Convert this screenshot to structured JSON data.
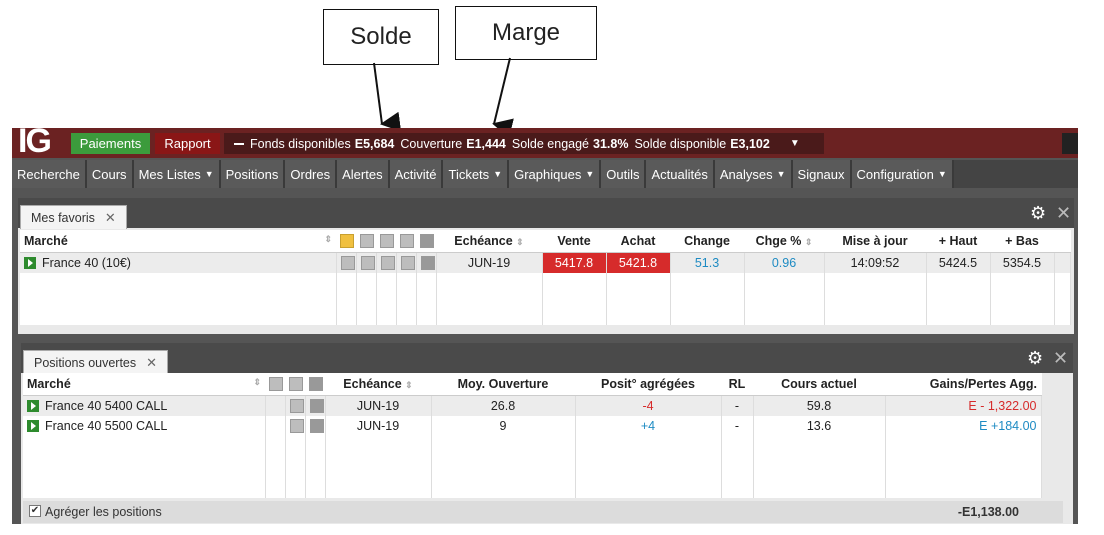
{
  "annotations": {
    "solde": "Solde",
    "marge": "Marge"
  },
  "topbar": {
    "logo": "IG",
    "payments": "Paiements",
    "report": "Rapport",
    "funds_label": "Fonds disponibles",
    "funds_value": "E5,684",
    "coverage_label": "Couverture",
    "coverage_value": "E1,444",
    "committed_label": "Solde engagé",
    "committed_value": "31.8%",
    "available_label": "Solde disponible",
    "available_value": "E3,102"
  },
  "menu": {
    "items": [
      "Recherche",
      "Cours",
      "Mes Listes",
      "Positions",
      "Ordres",
      "Alertes",
      "Activité",
      "Tickets",
      "Graphiques",
      "Outils",
      "Actualités",
      "Analyses",
      "Signaux",
      "Configuration"
    ]
  },
  "favorites": {
    "tab": "Mes favoris",
    "headers": {
      "market": "Marché",
      "expiry": "Echéance",
      "sell": "Vente",
      "buy": "Achat",
      "change": "Change",
      "change_pct": "Chge %",
      "updated": "Mise à jour",
      "high": "+ Haut",
      "low": "+ Bas"
    },
    "rows": [
      {
        "market": "France 40 (10€)",
        "expiry": "JUN-19",
        "sell": "5417.8",
        "buy": "5421.8",
        "change": "51.3",
        "change_pct": "0.96",
        "updated": "14:09:52",
        "high": "5424.5",
        "low": "5354.5"
      }
    ]
  },
  "positions": {
    "tab": "Positions ouvertes",
    "headers": {
      "market": "Marché",
      "expiry": "Echéance",
      "avg_open": "Moy. Ouverture",
      "aggregated": "Posit° agrégées",
      "rl": "RL",
      "current": "Cours actuel",
      "pnl": "Gains/Pertes Agg."
    },
    "rows": [
      {
        "market": "France 40 5400 CALL",
        "expiry": "JUN-19",
        "avg_open": "26.8",
        "aggregated": "-4",
        "rl": "-",
        "current": "59.8",
        "pnl": "E - 1,322.00"
      },
      {
        "market": "France 40 5500 CALL",
        "expiry": "JUN-19",
        "avg_open": "9",
        "aggregated": "+4",
        "rl": "-",
        "current": "13.6",
        "pnl": "E +184.00"
      }
    ],
    "aggregate_label": "Agréger les positions",
    "total": "-E1,138.00"
  },
  "colors": {
    "sell_red": "#d62b2b",
    "positive_blue": "#1e8bc3",
    "topbar": "#6b2222",
    "payments_green": "#3c9b3c"
  }
}
